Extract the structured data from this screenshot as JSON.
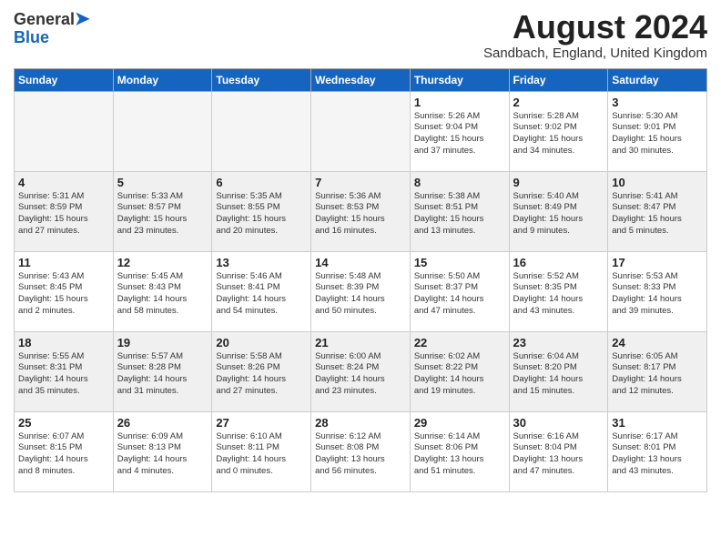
{
  "header": {
    "logo_line1": "General",
    "logo_line2": "Blue",
    "month_title": "August 2024",
    "location": "Sandbach, England, United Kingdom"
  },
  "weekdays": [
    "Sunday",
    "Monday",
    "Tuesday",
    "Wednesday",
    "Thursday",
    "Friday",
    "Saturday"
  ],
  "weeks": [
    [
      {
        "num": "",
        "info": "",
        "empty": true
      },
      {
        "num": "",
        "info": "",
        "empty": true
      },
      {
        "num": "",
        "info": "",
        "empty": true
      },
      {
        "num": "",
        "info": "",
        "empty": true
      },
      {
        "num": "1",
        "info": "Sunrise: 5:26 AM\nSunset: 9:04 PM\nDaylight: 15 hours\nand 37 minutes.",
        "empty": false
      },
      {
        "num": "2",
        "info": "Sunrise: 5:28 AM\nSunset: 9:02 PM\nDaylight: 15 hours\nand 34 minutes.",
        "empty": false
      },
      {
        "num": "3",
        "info": "Sunrise: 5:30 AM\nSunset: 9:01 PM\nDaylight: 15 hours\nand 30 minutes.",
        "empty": false
      }
    ],
    [
      {
        "num": "4",
        "info": "Sunrise: 5:31 AM\nSunset: 8:59 PM\nDaylight: 15 hours\nand 27 minutes.",
        "empty": false
      },
      {
        "num": "5",
        "info": "Sunrise: 5:33 AM\nSunset: 8:57 PM\nDaylight: 15 hours\nand 23 minutes.",
        "empty": false
      },
      {
        "num": "6",
        "info": "Sunrise: 5:35 AM\nSunset: 8:55 PM\nDaylight: 15 hours\nand 20 minutes.",
        "empty": false
      },
      {
        "num": "7",
        "info": "Sunrise: 5:36 AM\nSunset: 8:53 PM\nDaylight: 15 hours\nand 16 minutes.",
        "empty": false
      },
      {
        "num": "8",
        "info": "Sunrise: 5:38 AM\nSunset: 8:51 PM\nDaylight: 15 hours\nand 13 minutes.",
        "empty": false
      },
      {
        "num": "9",
        "info": "Sunrise: 5:40 AM\nSunset: 8:49 PM\nDaylight: 15 hours\nand 9 minutes.",
        "empty": false
      },
      {
        "num": "10",
        "info": "Sunrise: 5:41 AM\nSunset: 8:47 PM\nDaylight: 15 hours\nand 5 minutes.",
        "empty": false
      }
    ],
    [
      {
        "num": "11",
        "info": "Sunrise: 5:43 AM\nSunset: 8:45 PM\nDaylight: 15 hours\nand 2 minutes.",
        "empty": false
      },
      {
        "num": "12",
        "info": "Sunrise: 5:45 AM\nSunset: 8:43 PM\nDaylight: 14 hours\nand 58 minutes.",
        "empty": false
      },
      {
        "num": "13",
        "info": "Sunrise: 5:46 AM\nSunset: 8:41 PM\nDaylight: 14 hours\nand 54 minutes.",
        "empty": false
      },
      {
        "num": "14",
        "info": "Sunrise: 5:48 AM\nSunset: 8:39 PM\nDaylight: 14 hours\nand 50 minutes.",
        "empty": false
      },
      {
        "num": "15",
        "info": "Sunrise: 5:50 AM\nSunset: 8:37 PM\nDaylight: 14 hours\nand 47 minutes.",
        "empty": false
      },
      {
        "num": "16",
        "info": "Sunrise: 5:52 AM\nSunset: 8:35 PM\nDaylight: 14 hours\nand 43 minutes.",
        "empty": false
      },
      {
        "num": "17",
        "info": "Sunrise: 5:53 AM\nSunset: 8:33 PM\nDaylight: 14 hours\nand 39 minutes.",
        "empty": false
      }
    ],
    [
      {
        "num": "18",
        "info": "Sunrise: 5:55 AM\nSunset: 8:31 PM\nDaylight: 14 hours\nand 35 minutes.",
        "empty": false
      },
      {
        "num": "19",
        "info": "Sunrise: 5:57 AM\nSunset: 8:28 PM\nDaylight: 14 hours\nand 31 minutes.",
        "empty": false
      },
      {
        "num": "20",
        "info": "Sunrise: 5:58 AM\nSunset: 8:26 PM\nDaylight: 14 hours\nand 27 minutes.",
        "empty": false
      },
      {
        "num": "21",
        "info": "Sunrise: 6:00 AM\nSunset: 8:24 PM\nDaylight: 14 hours\nand 23 minutes.",
        "empty": false
      },
      {
        "num": "22",
        "info": "Sunrise: 6:02 AM\nSunset: 8:22 PM\nDaylight: 14 hours\nand 19 minutes.",
        "empty": false
      },
      {
        "num": "23",
        "info": "Sunrise: 6:04 AM\nSunset: 8:20 PM\nDaylight: 14 hours\nand 15 minutes.",
        "empty": false
      },
      {
        "num": "24",
        "info": "Sunrise: 6:05 AM\nSunset: 8:17 PM\nDaylight: 14 hours\nand 12 minutes.",
        "empty": false
      }
    ],
    [
      {
        "num": "25",
        "info": "Sunrise: 6:07 AM\nSunset: 8:15 PM\nDaylight: 14 hours\nand 8 minutes.",
        "empty": false
      },
      {
        "num": "26",
        "info": "Sunrise: 6:09 AM\nSunset: 8:13 PM\nDaylight: 14 hours\nand 4 minutes.",
        "empty": false
      },
      {
        "num": "27",
        "info": "Sunrise: 6:10 AM\nSunset: 8:11 PM\nDaylight: 14 hours\nand 0 minutes.",
        "empty": false
      },
      {
        "num": "28",
        "info": "Sunrise: 6:12 AM\nSunset: 8:08 PM\nDaylight: 13 hours\nand 56 minutes.",
        "empty": false
      },
      {
        "num": "29",
        "info": "Sunrise: 6:14 AM\nSunset: 8:06 PM\nDaylight: 13 hours\nand 51 minutes.",
        "empty": false
      },
      {
        "num": "30",
        "info": "Sunrise: 6:16 AM\nSunset: 8:04 PM\nDaylight: 13 hours\nand 47 minutes.",
        "empty": false
      },
      {
        "num": "31",
        "info": "Sunrise: 6:17 AM\nSunset: 8:01 PM\nDaylight: 13 hours\nand 43 minutes.",
        "empty": false
      }
    ]
  ]
}
